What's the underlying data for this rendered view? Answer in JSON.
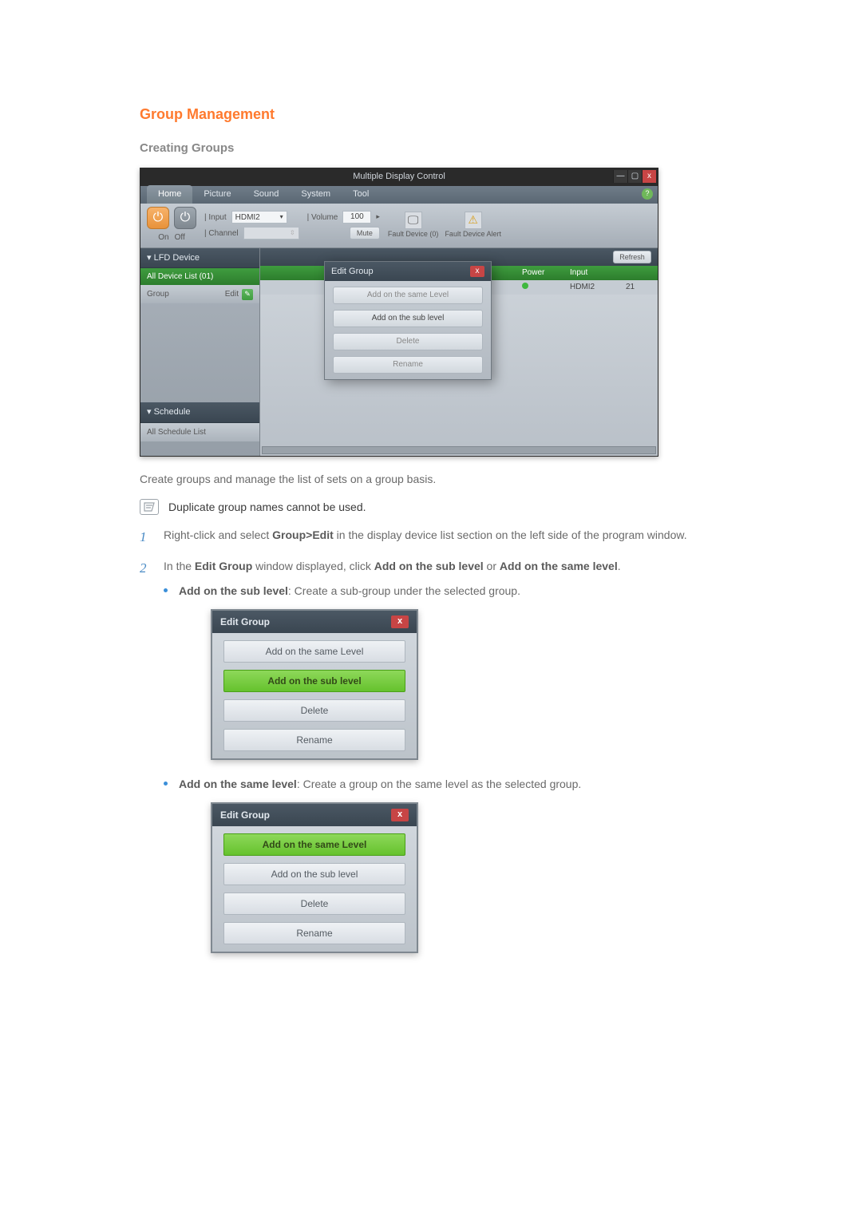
{
  "headings": {
    "main": "Group Management",
    "sub": "Creating Groups"
  },
  "mdc_window": {
    "title": "Multiple Display Control",
    "win_min": "—",
    "win_max": "▢",
    "win_close": "x",
    "menu": {
      "home": "Home",
      "picture": "Picture",
      "sound": "Sound",
      "system": "System",
      "tool": "Tool"
    },
    "toolbar": {
      "on_label": "On",
      "off_label": "Off",
      "input_label": "| Input",
      "input_value": "HDMI2",
      "channel_label": "| Channel",
      "volume_label": "| Volume",
      "volume_value": "100",
      "mute_label": "Mute",
      "fault0": "Fault Device (0)",
      "fault_alert": "Fault Device Alert"
    },
    "sidebar": {
      "lfd": "▾  LFD Device",
      "all_device": "All Device List (01)",
      "group_label": "Group",
      "edit_label": "Edit",
      "schedule": "▾  Schedule",
      "all_schedule": "All Schedule List"
    },
    "main": {
      "refresh": "Refresh",
      "col_power": "Power",
      "col_input": "Input",
      "val_input": "HDMI2",
      "val_count": "21"
    },
    "popup": {
      "title": "Edit Group",
      "close": "x",
      "btn_same": "Add on the same Level",
      "btn_sub": "Add on the sub level",
      "btn_delete": "Delete",
      "btn_rename": "Rename"
    }
  },
  "body": {
    "intro": "Create groups and manage the list of sets on a group basis.",
    "note": "Duplicate group names cannot be used.",
    "step1_a": "Right-click and select ",
    "step1_bold": "Group>Edit",
    "step1_b": " in the display device list section on the left side of the program window.",
    "step2_a": "In the ",
    "step2_bold1": "Edit Group",
    "step2_b": " window displayed, click ",
    "step2_bold2": "Add on the sub level",
    "step2_c": " or ",
    "step2_bold3": "Add on the same level",
    "step2_d": ".",
    "bullet1_bold": "Add on the sub level",
    "bullet1_text": ": Create a sub-group under the selected group.",
    "bullet2_bold": "Add on the same level",
    "bullet2_text": ": Create a group on the same level as the selected group."
  },
  "dialog": {
    "title": "Edit Group",
    "close": "x",
    "same": "Add on the same Level",
    "sub": "Add on the sub level",
    "delete": "Delete",
    "rename": "Rename"
  }
}
